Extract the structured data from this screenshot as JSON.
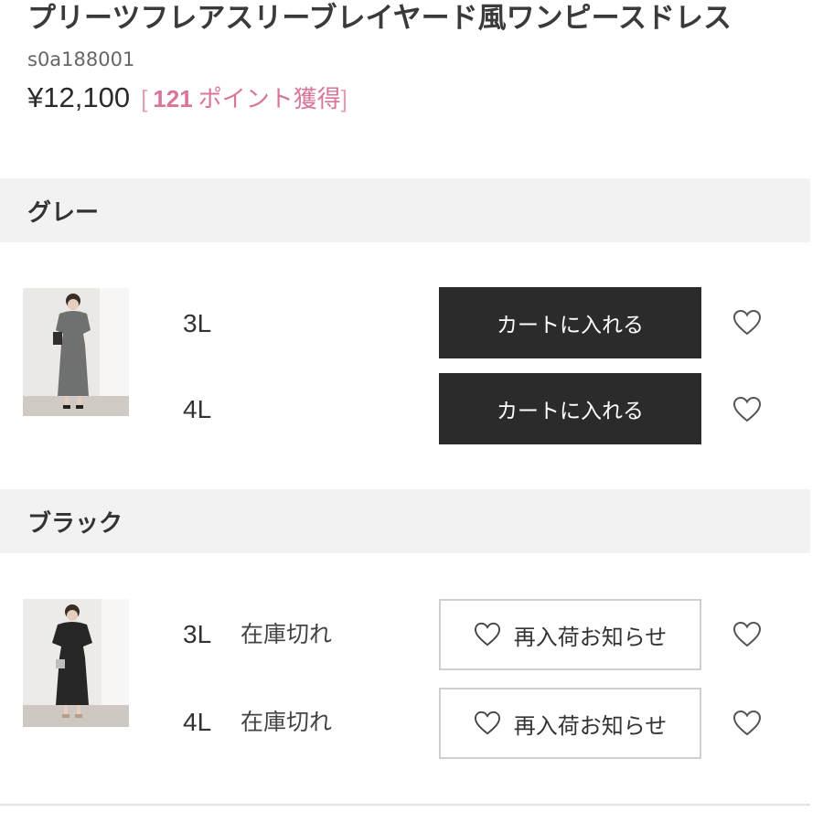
{
  "product": {
    "title": "プリーツフレアスリーブレイヤード風ワンピースドレス",
    "sku": "s0a188001",
    "price": "¥12,100",
    "points_open": "[",
    "points_value": "121",
    "points_label": "ポイント獲得",
    "points_close": "]",
    "points_color": "#d9749a"
  },
  "variants": [
    {
      "color_name": "グレー",
      "image": "photo of model in gray pleated dress",
      "sizes": [
        {
          "size": "3L",
          "stock_text": "",
          "button": "カートに入れる",
          "favorite_icon": "heart-outline-icon"
        },
        {
          "size": "4L",
          "stock_text": "",
          "button": "カートに入れる",
          "favorite_icon": "heart-outline-icon"
        }
      ]
    },
    {
      "color_name": "ブラック",
      "image": "photo of model in black pleated dress",
      "sizes": [
        {
          "size": "3L",
          "stock_text": "在庫切れ",
          "button": "再入荷お知らせ",
          "favorite_icon": "heart-outline-icon"
        },
        {
          "size": "4L",
          "stock_text": "在庫切れ",
          "button": "再入荷お知らせ",
          "favorite_icon": "heart-outline-icon"
        }
      ]
    }
  ],
  "colors": {
    "cart_button_bg": "#2b2b2b",
    "section_bg": "#f2f2f2",
    "notify_border": "#cfcfcf"
  }
}
